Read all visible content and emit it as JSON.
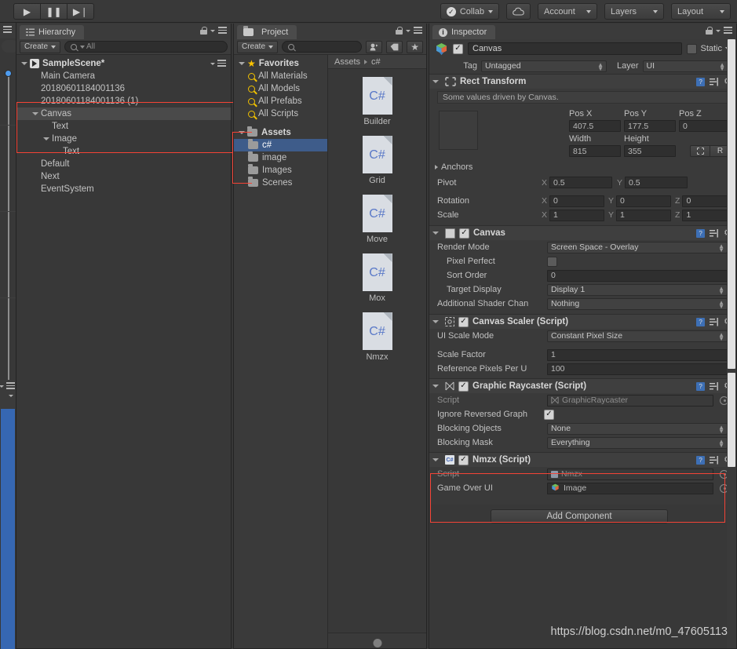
{
  "toolbar": {
    "play_icon": "play-icon",
    "pause_icon": "pause-icon",
    "step_icon": "step-icon",
    "collab_label": "Collab",
    "cloud_icon": "cloud-icon",
    "account_label": "Account",
    "layers_label": "Layers",
    "layout_label": "Layout"
  },
  "hierarchy": {
    "tab_label": "Hierarchy",
    "create_label": "Create",
    "search_placeholder": "Q All",
    "scene_name": "SampleScene*",
    "items": [
      {
        "label": "Main Camera",
        "indent": 1,
        "expandable": false,
        "selected": false
      },
      {
        "label": "20180601184001136",
        "indent": 1,
        "expandable": false,
        "selected": false
      },
      {
        "label": "20180601184001136 (1)",
        "indent": 1,
        "expandable": false,
        "selected": false
      },
      {
        "label": "Canvas",
        "indent": 1,
        "expandable": true,
        "selected": true
      },
      {
        "label": "Text",
        "indent": 2,
        "expandable": false,
        "selected": false
      },
      {
        "label": "Image",
        "indent": 2,
        "expandable": true,
        "selected": false
      },
      {
        "label": "Text",
        "indent": 3,
        "expandable": false,
        "selected": false
      },
      {
        "label": "Default",
        "indent": 1,
        "expandable": false,
        "selected": false
      },
      {
        "label": "Next",
        "indent": 1,
        "expandable": false,
        "selected": false
      },
      {
        "label": "EventSystem",
        "indent": 1,
        "expandable": false,
        "selected": false
      }
    ]
  },
  "project": {
    "tab_label": "Project",
    "create_label": "Create",
    "search_placeholder": "",
    "breadcrumb": [
      "Assets",
      "c#"
    ],
    "favorites_label": "Favorites",
    "favorites": [
      "All Materials",
      "All Models",
      "All Prefabs",
      "All Scripts"
    ],
    "assets_label": "Assets",
    "folders": [
      {
        "label": "c#",
        "selected": true
      },
      {
        "label": "image",
        "selected": false
      },
      {
        "label": "Images",
        "selected": false
      },
      {
        "label": "Scenes",
        "selected": false
      }
    ],
    "files": [
      {
        "name": "Builder",
        "type": "C#"
      },
      {
        "name": "Grid",
        "type": "C#"
      },
      {
        "name": "Move",
        "type": "C#"
      },
      {
        "name": "Mox",
        "type": "C#"
      },
      {
        "name": "Nmzx",
        "type": "C#"
      }
    ]
  },
  "inspector": {
    "tab_label": "Inspector",
    "object_name": "Canvas",
    "object_enabled": true,
    "static_label": "Static",
    "static_checked": false,
    "tag_label": "Tag",
    "tag_value": "Untagged",
    "layer_label": "Layer",
    "layer_value": "UI",
    "add_component_label": "Add Component",
    "components": [
      {
        "title": "Rect Transform",
        "enabled": null,
        "icon": "rect-transform-icon",
        "helpbox": "Some values driven by Canvas.",
        "fields": [
          {
            "name": "Pos X",
            "value": "407.5"
          },
          {
            "name": "Pos Y",
            "value": "177.5"
          },
          {
            "name": "Pos Z",
            "value": "0"
          },
          {
            "name": "Width",
            "value": "815"
          },
          {
            "name": "Height",
            "value": "355"
          },
          {
            "name": "Anchors",
            "value": ""
          },
          {
            "name": "Pivot",
            "x": "0.5",
            "y": "0.5"
          },
          {
            "name": "Rotation",
            "x": "0",
            "y": "0",
            "z": "0"
          },
          {
            "name": "Scale",
            "x": "1",
            "y": "1",
            "z": "1"
          }
        ],
        "blueprint_label": "",
        "raw_label": "R"
      },
      {
        "title": "Canvas",
        "enabled": true,
        "icon": "canvas-icon",
        "fields": [
          {
            "name": "Render Mode",
            "value": "Screen Space - Overlay",
            "type": "dropdown"
          },
          {
            "name": "Pixel Perfect",
            "value": "",
            "type": "checkbox",
            "checked": false
          },
          {
            "name": "Sort Order",
            "value": "0",
            "type": "text"
          },
          {
            "name": "Target Display",
            "value": "Display 1",
            "type": "dropdown"
          },
          {
            "name": "Additional Shader Chan",
            "value": "Nothing",
            "type": "dropdown"
          }
        ]
      },
      {
        "title": "Canvas Scaler (Script)",
        "enabled": true,
        "icon": "canvas-scaler-icon",
        "fields": [
          {
            "name": "UI Scale Mode",
            "value": "Constant Pixel Size",
            "type": "dropdown"
          },
          {
            "name": "Scale Factor",
            "value": "1",
            "type": "text"
          },
          {
            "name": "Reference Pixels Per U",
            "value": "100",
            "type": "text"
          }
        ]
      },
      {
        "title": "Graphic Raycaster (Script)",
        "enabled": true,
        "icon": "graphic-raycaster-icon",
        "fields": [
          {
            "name": "Script",
            "value": "GraphicRaycaster",
            "type": "object",
            "dim": true
          },
          {
            "name": "Ignore Reversed Graph",
            "value": "",
            "type": "checkbox",
            "checked": true
          },
          {
            "name": "Blocking Objects",
            "value": "None",
            "type": "dropdown"
          },
          {
            "name": "Blocking Mask",
            "value": "Everything",
            "type": "dropdown"
          }
        ]
      },
      {
        "title": "Nmzx (Script)",
        "enabled": true,
        "icon": "cs-script-icon",
        "highlighted": true,
        "fields": [
          {
            "name": "Script",
            "value": "Nmzx",
            "type": "object",
            "dim": true
          },
          {
            "name": "Game Over UI",
            "value": "Image",
            "type": "object",
            "dim": false
          }
        ]
      }
    ]
  },
  "watermark": "https://blog.csdn.net/m0_47605113"
}
